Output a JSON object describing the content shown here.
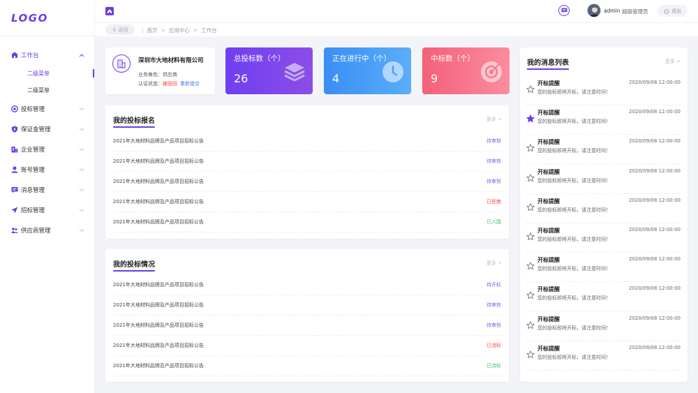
{
  "logo": "LOGO",
  "sidebar": {
    "items": [
      {
        "label": "工作台",
        "icon": "home-icon"
      },
      {
        "label": "投标管理",
        "icon": "target-icon"
      },
      {
        "label": "保证金管理",
        "icon": "shield-icon"
      },
      {
        "label": "企业管理",
        "icon": "building-icon"
      },
      {
        "label": "账号管理",
        "icon": "user-icon"
      },
      {
        "label": "消息管理",
        "icon": "message-icon"
      },
      {
        "label": "招标管理",
        "icon": "send-icon"
      },
      {
        "label": "供应商管理",
        "icon": "supplier-icon"
      }
    ],
    "submenu": [
      "二级菜单",
      "二级菜单"
    ]
  },
  "header": {
    "username": "admin",
    "role": "超级管理员",
    "logout": "退出"
  },
  "breadcrumb": {
    "back": "返回",
    "items": [
      "首页",
      "应用中心",
      "工作台"
    ]
  },
  "company": {
    "name": "深圳市大地材料有限公司",
    "role_line": "业务角色：供应商",
    "status_prefix": "认证状态：",
    "status": "被驳回",
    "resubmit": "重新提交"
  },
  "stats": [
    {
      "label": "总投标数（个）",
      "value": "26",
      "icon": "layers-icon"
    },
    {
      "label": "正在进行中（个）",
      "value": "4",
      "icon": "clock-icon"
    },
    {
      "label": "中标数（个）",
      "value": "9",
      "icon": "target-icon"
    }
  ],
  "colors": {
    "accent": "#6a3ce6",
    "red": "#f44444",
    "green": "#39c36b",
    "blue": "#3b7cf0"
  },
  "bids_signup": {
    "title": "我的投标报名",
    "more": "更多",
    "rows": [
      {
        "name": "2021年大地材料品牌及产品项目招标公告",
        "status": "待审核",
        "tone": "purple"
      },
      {
        "name": "2021年大地材料品牌及产品项目招标公告",
        "status": "待审核",
        "tone": "purple"
      },
      {
        "name": "2021年大地材料品牌及产品项目招标公告",
        "status": "待审核",
        "tone": "purple"
      },
      {
        "name": "2021年大地材料品牌及产品项目招标公告",
        "status": "已拒绝",
        "tone": "red"
      },
      {
        "name": "2021年大地材料品牌及产品项目招标公告",
        "status": "已入围",
        "tone": "green"
      }
    ]
  },
  "bids_status": {
    "title": "我的投标情况",
    "more": "更多",
    "rows": [
      {
        "name": "2021年大地材料品牌及产品项目招标公告",
        "status": "待开标",
        "tone": "purple"
      },
      {
        "name": "2021年大地材料品牌及产品项目招标公告",
        "status": "待审核",
        "tone": "purple"
      },
      {
        "name": "2021年大地材料品牌及产品项目招标公告",
        "status": "待审核",
        "tone": "purple"
      },
      {
        "name": "2021年大地材料品牌及产品项目招标公告",
        "status": "已流标",
        "tone": "red"
      },
      {
        "name": "2021年大地材料品牌及产品项目招标公告",
        "status": "已流标",
        "tone": "green"
      }
    ]
  },
  "messages": {
    "title": "我的消息列表",
    "more": "更多",
    "items": [
      {
        "title": "开标提醒",
        "time": "2020/09/08 12:00:00",
        "desc": "您的投标即将开标，请注意时间！",
        "starred": false
      },
      {
        "title": "开标提醒",
        "time": "2020/09/08 12:00:00",
        "desc": "您的投标即将开标，请注意时间！",
        "starred": true
      },
      {
        "title": "开标提醒",
        "time": "2020/09/08 12:00:00",
        "desc": "您的投标即将开标，请注意时间！",
        "starred": false
      },
      {
        "title": "开标提醒",
        "time": "2020/09/08 12:00:00",
        "desc": "您的投标即将开标，请注意时间！",
        "starred": false
      },
      {
        "title": "开标提醒",
        "time": "2020/09/08 12:00:00",
        "desc": "您的投标即将开标，请注意时间！",
        "starred": false
      },
      {
        "title": "开标提醒",
        "time": "2020/09/08 12:00:00",
        "desc": "您的投标即将开标，请注意时间！",
        "starred": false
      },
      {
        "title": "开标提醒",
        "time": "2020/09/08 12:00:00",
        "desc": "您的投标即将开标，请注意时间！",
        "starred": false
      },
      {
        "title": "开标提醒",
        "time": "2020/09/08 12:00:00",
        "desc": "您的投标即将开标，请注意时间！",
        "starred": false
      },
      {
        "title": "开标提醒",
        "time": "2020/09/08 12:00:00",
        "desc": "您的投标即将开标，请注意时间！",
        "starred": false
      },
      {
        "title": "开标提醒",
        "time": "2020/09/08 12:00:00",
        "desc": "您的投标即将开标，请注意时间！",
        "starred": false
      }
    ]
  }
}
